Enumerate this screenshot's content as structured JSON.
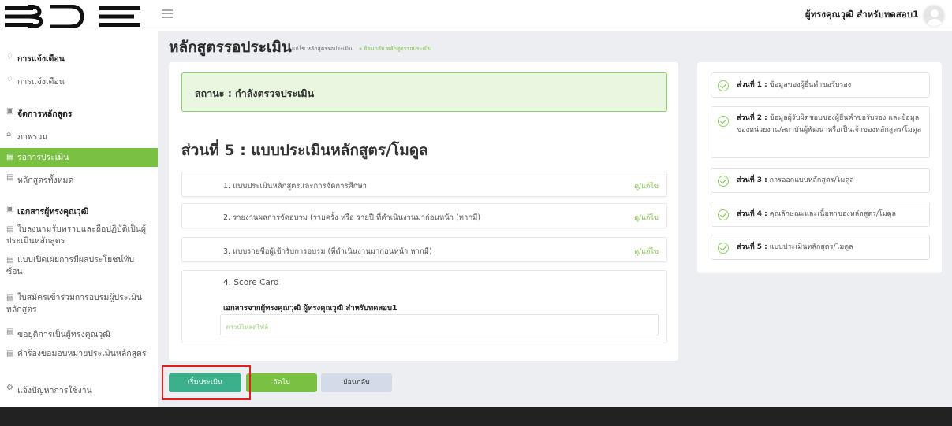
{
  "header": {
    "logo_text": "BDE",
    "user_name": "ผู้ทรงคุณวุฒิ สำหรับทดสอบ1"
  },
  "sidebar": {
    "items": [
      {
        "label": "การแจ้งเตือน",
        "icon": "bell-icon",
        "type": "heading"
      },
      {
        "label": "การแจ้งเตือน",
        "icon": "bell-icon",
        "type": "link"
      },
      {
        "label": "จัดการหลักสูตร",
        "icon": "list-icon",
        "type": "heading"
      },
      {
        "label": "ภาพรวม",
        "icon": "home-icon",
        "type": "link"
      },
      {
        "label": "รอการประเมิน",
        "icon": "document-icon",
        "type": "link",
        "active": true
      },
      {
        "label": "หลักสูตรทั้งหมด",
        "icon": "document-icon",
        "type": "link"
      },
      {
        "label": "เอกสารผู้ทรงคุณวุฒิ",
        "icon": "list-icon",
        "type": "heading"
      },
      {
        "label": "ใบลงนามรับทราบและถือปฏิบัติเป็นผู้ประเมินหลักสูตร",
        "icon": "document-icon",
        "type": "link"
      },
      {
        "label": "แบบเปิดเผยการมีผลประโยชน์ทับซ้อน",
        "icon": "document-icon",
        "type": "link"
      },
      {
        "label": "ใบสมัครเข้าร่วมการอบรมผู้ประเมินหลักสูตร",
        "icon": "document-icon",
        "type": "link"
      },
      {
        "label": "ขอยุติการเป็นผู้ทรงคุณวุฒิ",
        "icon": "document-icon",
        "type": "link"
      },
      {
        "label": "คำร้องขอมอบหมายประเมินหลักสูตร",
        "icon": "document-icon",
        "type": "link"
      },
      {
        "label": "แจ้งปัญหาการใช้งาน",
        "icon": "gear-icon",
        "type": "link"
      }
    ]
  },
  "main": {
    "title": "หลักสูตรรอประเมิน",
    "breadcrumb": "แก้ไข หลักสูตรรอประเมิน.",
    "back_link": "« ย้อนกลับ หลักสูตรรอประเมิน",
    "status": "สถานะ : กำลังตรวจประเมิน",
    "section_title": "ส่วนที่ 5 : แบบประเมินหลักสูตร/โมดูล",
    "rows": [
      {
        "label": "1. แบบประเมินหลักสูตรและการจัดการศึกษา",
        "action": "ดู/แก้ไข"
      },
      {
        "label": "2. รายงานผลการจัดอบรม (รายครั้ง หรือ รายปี ที่ดำเนินงานมาก่อนหน้า (หากมี)",
        "action": "ดู/แก้ไข"
      },
      {
        "label": "3. แบบรายชื่อผู้เข้ารับการอบรม (ที่ดำเนินงานมาก่อนหน้า หากมี)",
        "action": "ดู/แก้ไข"
      }
    ],
    "score_card": {
      "label": "4. Score Card",
      "subtitle": "เอกสารจากผู้ทรงคุณวุฒิ ผู้ทรงคุณวุฒิ สำหรับทดสอบ1",
      "download": "ดาวน์โหลดไฟล์"
    },
    "buttons": {
      "start": "เริ่มประเมิน",
      "next": "ถัดไป",
      "back": "ย้อนกลับ"
    }
  },
  "steps": [
    {
      "part": "ส่วนที่ 1 :",
      "text": " ข้อมูลของผู้ยื่นคำขอรับรอง"
    },
    {
      "part": "ส่วนที่ 2 :",
      "text": " ข้อมูลผู้รับผิดชอบของผู้ยื่นคำขอรับรอง และข้อมูลของหน่วยงาน/สถาบันผู้พัฒนาหรือเป็นเจ้าของหลักสูตร/โมดูล"
    },
    {
      "part": "ส่วนที่ 3 :",
      "text": " การออกแบบหลักสูตร/โมดูล"
    },
    {
      "part": "ส่วนที่ 4 :",
      "text": " คุณลักษณะและเนื้อหาของหลักสูตร/โมดูล"
    },
    {
      "part": "ส่วนที่ 5 :",
      "text": " แบบประเมินหลักสูตร/โมดูล"
    }
  ],
  "colors": {
    "accent": "#7ac143",
    "start_button": "#3bb08b",
    "highlight": "#e02020"
  }
}
